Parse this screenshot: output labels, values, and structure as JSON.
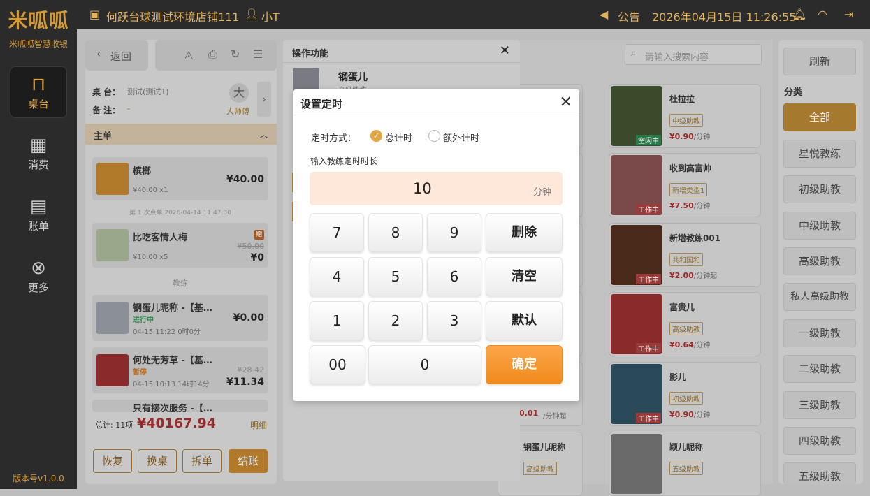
{
  "app": {
    "logo": "米呱呱",
    "subtitle": "米呱呱智慧收银",
    "version": "版本号v1.0.0"
  },
  "nav": [
    {
      "label": "桌台",
      "icon": "table-icon"
    },
    {
      "label": "消费",
      "icon": "grid-icon"
    },
    {
      "label": "账单",
      "icon": "clipboard-icon"
    },
    {
      "label": "更多",
      "icon": "more-icon"
    }
  ],
  "topbar": {
    "store": "何跃台球测试环境店铺111",
    "user": "小T",
    "announcement": "公告",
    "datetime": "2026年04月15日 11:26:55"
  },
  "left": {
    "back": "返回",
    "table_label": "桌 台：",
    "table_value": "测试(测试1)",
    "remark_label": "备 注：",
    "remark_value": "-",
    "master_avatar": "大",
    "master_name": "大师傅",
    "section_main": "主单",
    "items": [
      {
        "name": "槟榔",
        "sub": "¥40.00 x1",
        "price": "¥40.00"
      },
      {
        "divider": "第 1 次点单 2026-04-14 11:47:30"
      },
      {
        "name": "比吃客情人梅",
        "sub": "¥10.00 x5",
        "orig": "¥50.00",
        "price": "¥0",
        "badge": "赠"
      }
    ],
    "section_coach": "教练",
    "coaches": [
      {
        "name": "钢蛋儿昵称 -【基…",
        "status": "进行中",
        "time": "04-15 11:22 0时0分",
        "price": "¥0.00"
      },
      {
        "name": "何处无芳草 -【基…",
        "status": "暂停",
        "time": "04-15 10:13 14时14分",
        "orig": "¥28.42",
        "price": "¥11.34"
      },
      {
        "name": "只有接次服务 -【…"
      }
    ],
    "total_label": "总计: 11项",
    "total": "¥40167.94",
    "detail": "明细",
    "buttons": [
      "恢复",
      "换桌",
      "拆单",
      "结账"
    ]
  },
  "op": {
    "title": "操作功能",
    "coach_name": "钢蛋儿",
    "coach_level": "高级助教"
  },
  "search": {
    "placeholder": "请输入搜索内容"
  },
  "right": {
    "refresh": "刷新",
    "category_title": "分类",
    "categories": [
      "全部",
      "星悦教练",
      "初级助教",
      "中级助教",
      "高级助教",
      "私人高级助教",
      "一级助教",
      "二级助教",
      "三级助教",
      "四级助教",
      "五级助教"
    ]
  },
  "coaches_grid": [
    {
      "name": "杜拉拉",
      "level": "中级助教",
      "price": "¥0.90",
      "unit": "/分钟",
      "status": "空闲中"
    },
    {
      "name": "收到高富帅",
      "level": "新增类型1",
      "price": "¥7.50",
      "unit": "/分钟",
      "status": "工作中"
    },
    {
      "name": "新增教练001",
      "level": "共和国和",
      "price": "¥2.00",
      "unit": "/分钟起",
      "status": "工作中"
    },
    {
      "name": "富贵儿",
      "level": "高级助教",
      "price": "¥0.64",
      "unit": "/分钟",
      "status": "工作中"
    },
    {
      "name": "影儿",
      "level": "初级助教",
      "price": "¥0.90",
      "unit": "/分钟",
      "status": "工作中"
    },
    {
      "name": "颖儿昵称",
      "level": "五级助教",
      "price": "",
      "unit": "",
      "status": ""
    }
  ],
  "grid_left_partial": {
    "name_partial": "…",
    "price_partial": "0.01",
    "unit_partial": "/分钟起",
    "name2": "钢蛋儿昵称",
    "level2": "高级助教"
  },
  "dialog": {
    "title": "设置定时",
    "mode_label": "定时方式：",
    "mode_total": "总计时",
    "mode_extra": "额外计时",
    "duration_label": "输入教练定时时长",
    "value": "10",
    "unit": "分钟",
    "keys": [
      "7",
      "8",
      "9",
      "删除",
      "4",
      "5",
      "6",
      "清空",
      "1",
      "2",
      "3",
      "默认",
      "00",
      "0",
      "确定"
    ]
  },
  "colors": {
    "accent": "#e2a544",
    "confirm": "#f7922a",
    "input_bg": "#fde8d9",
    "price_red": "#c0202a"
  }
}
